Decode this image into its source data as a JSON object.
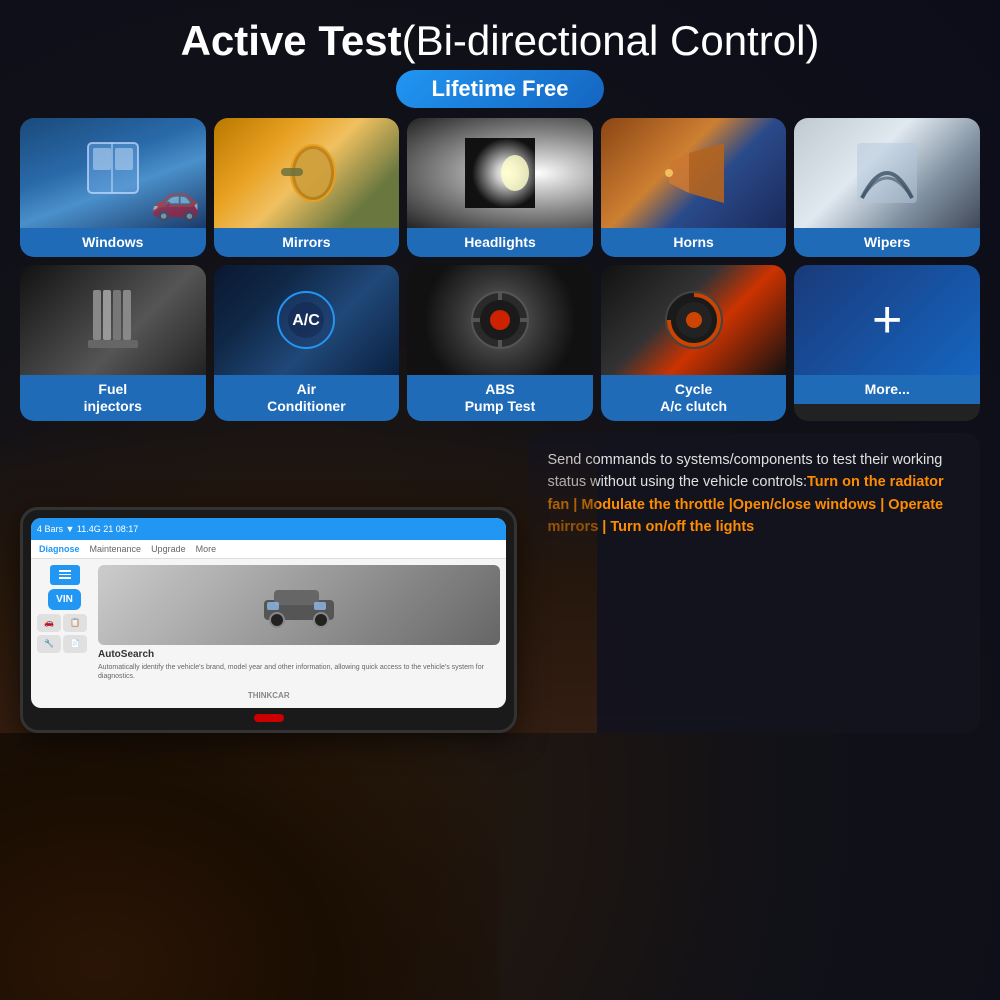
{
  "page": {
    "title": "Active Test",
    "title_paren": "(Bi-directional Control)",
    "badge": "Lifetime Free"
  },
  "features_top": [
    {
      "id": "windows",
      "label": "Windows",
      "img_class": "car-window-img",
      "emoji": "🪟"
    },
    {
      "id": "mirrors",
      "label": "Mirrors",
      "img_class": "mirror-img",
      "emoji": "🪞"
    },
    {
      "id": "headlights",
      "label": "Headlights",
      "img_class": "headlight-img",
      "emoji": "💡"
    },
    {
      "id": "horns",
      "label": "Horns",
      "img_class": "horn-img",
      "emoji": "📣"
    },
    {
      "id": "wipers",
      "label": "Wipers",
      "img_class": "wiper-img",
      "emoji": "🌧️"
    }
  ],
  "features_bottom": [
    {
      "id": "fuel-injectors",
      "label": "Fuel\ninjectors",
      "img_class": "fuel-img",
      "emoji": "⚙️"
    },
    {
      "id": "air-conditioner",
      "label": "Air\nConditioner",
      "img_class": "ac-img",
      "emoji": "❄️"
    },
    {
      "id": "abs-pump",
      "label": "ABS\nPump Test",
      "img_class": "abs-img",
      "emoji": "🔧"
    },
    {
      "id": "cycle-ac",
      "label": "Cycle\nA/c clutch",
      "img_class": "cycle-img",
      "emoji": "🔄"
    }
  ],
  "more_card": {
    "plus": "+",
    "label": "More..."
  },
  "tablet": {
    "brand": "THINKCAR",
    "nav_items": [
      "Diagnose",
      "Maintenance",
      "Upgrade",
      "More"
    ],
    "autosearch_title": "AutoSearch",
    "autosearch_desc": "Automatically identify the vehicle's brand, model year and other information, allowing quick access to the vehicle's system for diagnostics."
  },
  "description": {
    "normal_text": "Send commands to systems/components to test their working status without using the vehicle controls:",
    "orange_text": "Turn on the radiator fan | Modulate the throttle |Open/close windows | Operate mirrors | Turn on/off the lights"
  },
  "colors": {
    "accent_blue": "#2196F3",
    "orange": "#ff8c00",
    "bg_dark": "#1a1a2e"
  }
}
